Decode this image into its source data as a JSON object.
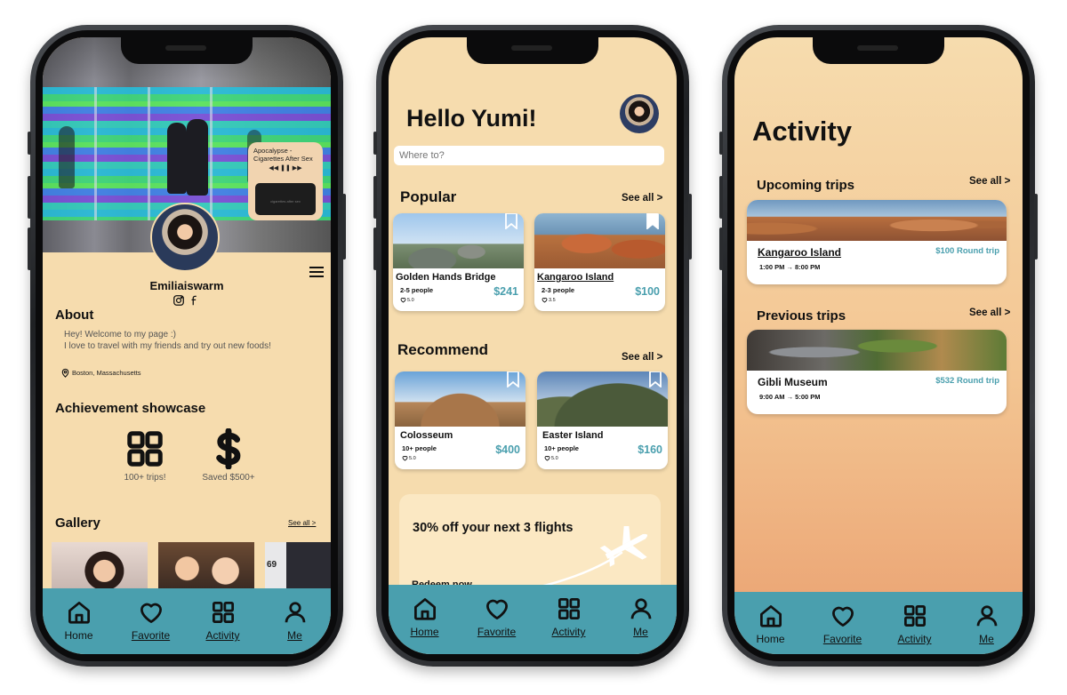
{
  "nav": {
    "home": "Home",
    "favorite": "Favorite",
    "activity": "Activity",
    "me": "Me"
  },
  "profile": {
    "music": {
      "track": "Apocalypse - Cigarettes After Sex",
      "controls": "◀◀ ❚❚ ▶▶",
      "box_text": "cigarettes after sex"
    },
    "username": "Emiliaiswarm",
    "about_title": "About",
    "about_text_1": "Hey! Welcome to my page :)",
    "about_text_2": "I love to travel with my friends and try out new foods!",
    "location": "Boston, Massachusetts",
    "achievements_title": "Achievement showcase",
    "achievements": [
      {
        "label": "100+ trips!",
        "icon": "grid-icon"
      },
      {
        "label": "Saved $500+",
        "icon": "dollar-icon"
      }
    ],
    "gallery_title": "Gallery",
    "gallery_see_all": "See all >",
    "gallery_badge": "69"
  },
  "home": {
    "greeting": "Hello Yumi!",
    "search_placeholder": "Where to?",
    "popular_title": "Popular",
    "recommend_title": "Recommend",
    "see_all": "See all >",
    "popular": [
      {
        "name": "Golden Hands Bridge",
        "people": "2-5 people",
        "rating": "5.0",
        "price": "$241"
      },
      {
        "name": "Kangaroo Island",
        "people": "2-3 people",
        "rating": "3.5",
        "price": "$100"
      }
    ],
    "recommend": [
      {
        "name": "Colosseum",
        "people": "10+ people",
        "rating": "5.0",
        "price": "$400"
      },
      {
        "name": "Easter Island",
        "people": "10+ people",
        "rating": "5.0",
        "price": "$160"
      }
    ],
    "promo_title": "30% off your next 3 flights",
    "promo_cta": "Redeem now →"
  },
  "activity": {
    "title": "Activity",
    "upcoming_title": "Upcoming trips",
    "previous_title": "Previous trips",
    "see_all": "See all >",
    "upcoming": {
      "name": "Kangaroo Island",
      "time": "1:00 PM → 8:00 PM",
      "price": "$100 Round trip"
    },
    "previous": {
      "name": "Gibli Museum",
      "time": "9:00 AM → 5:00 PM",
      "price": "$532 Round trip"
    }
  },
  "colors": {
    "background": "#f6dcae",
    "nav": "#4a9fae",
    "accent_price": "#4a9fae"
  }
}
